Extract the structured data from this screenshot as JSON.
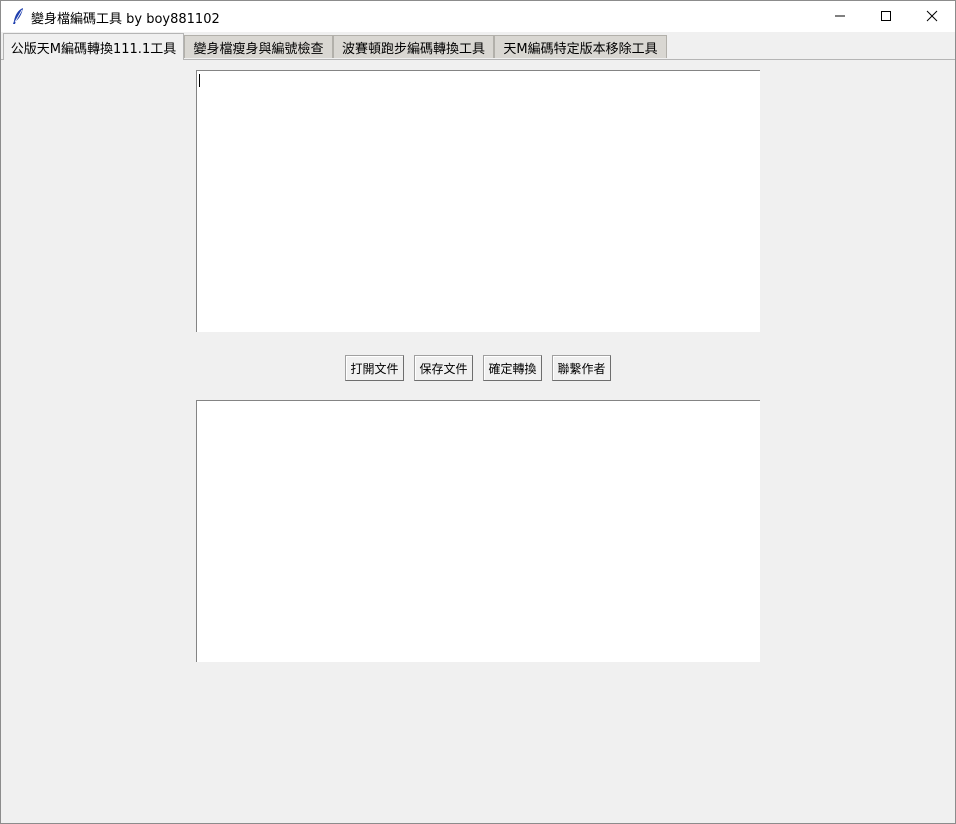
{
  "window": {
    "title": "變身檔編碼工具 by boy881102",
    "icons": {
      "app": "feather-icon",
      "minimize": "minimize-icon",
      "maximize": "maximize-icon",
      "close": "close-icon"
    }
  },
  "tabs": [
    {
      "label": "公版天M編碼轉換111.1工具",
      "active": true
    },
    {
      "label": "變身檔瘦身與編號檢查",
      "active": false
    },
    {
      "label": "波賽頓跑步編碼轉換工具",
      "active": false
    },
    {
      "label": "天M編碼特定版本移除工具",
      "active": false
    }
  ],
  "main": {
    "input_text": "",
    "output_text": "",
    "buttons": {
      "open": "打開文件",
      "save": "保存文件",
      "convert": "確定轉換",
      "contact": "聯繫作者"
    }
  }
}
